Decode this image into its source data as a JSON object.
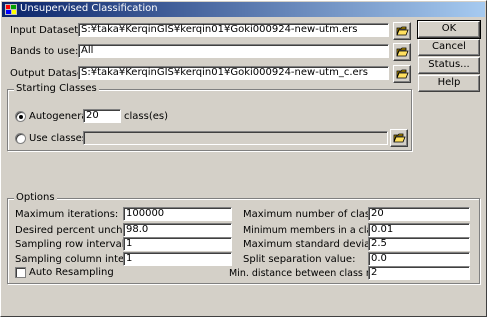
{
  "window": {
    "title": "Unsupervised Classification"
  },
  "fields": {
    "input_dataset": {
      "label": "Input Dataset:",
      "value": "S:¥taka¥KerqinGIS¥kerqin01¥Goki000924-new-utm.ers"
    },
    "bands_to_use": {
      "label": "Bands to use:",
      "value": "All"
    },
    "output_dataset": {
      "label": "Output Dataset:",
      "value": "S:¥taka¥KerqinGIS¥kerqin01¥Goki000924-new-utm_c.ers"
    }
  },
  "buttons": {
    "ok": "OK",
    "cancel": "Cancel",
    "status": "Status...",
    "help": "Help"
  },
  "starting_classes": {
    "title": "Starting Classes",
    "autogenerate_label": "Autogenerate:",
    "autogenerate_value": "20",
    "classes_suffix": "class(es)",
    "use_classes_label": "Use classes:",
    "use_classes_value": "",
    "selected": "autogenerate"
  },
  "options": {
    "title": "Options",
    "left": [
      {
        "label": "Maximum iterations:",
        "value": "100000"
      },
      {
        "label": "Desired percent unchanged:",
        "value": "98.0"
      },
      {
        "label": "Sampling row interval:",
        "value": "1"
      },
      {
        "label": "Sampling column interval:",
        "value": "1"
      }
    ],
    "right": [
      {
        "label": "Maximum number of classes:",
        "value": "20"
      },
      {
        "label": "Minimum members in a class (%):",
        "value": "0.01"
      },
      {
        "label": "Maximum standard deviation:",
        "value": "2.5"
      },
      {
        "label": "Split separation value:",
        "value": "0.0"
      },
      {
        "label": "Min. distance between class means:",
        "value": "2"
      }
    ],
    "auto_resampling_label": "Auto Resampling",
    "auto_resampling_checked": false
  },
  "icons": {
    "folder": "folder-open-icon",
    "app": "app-icon"
  }
}
